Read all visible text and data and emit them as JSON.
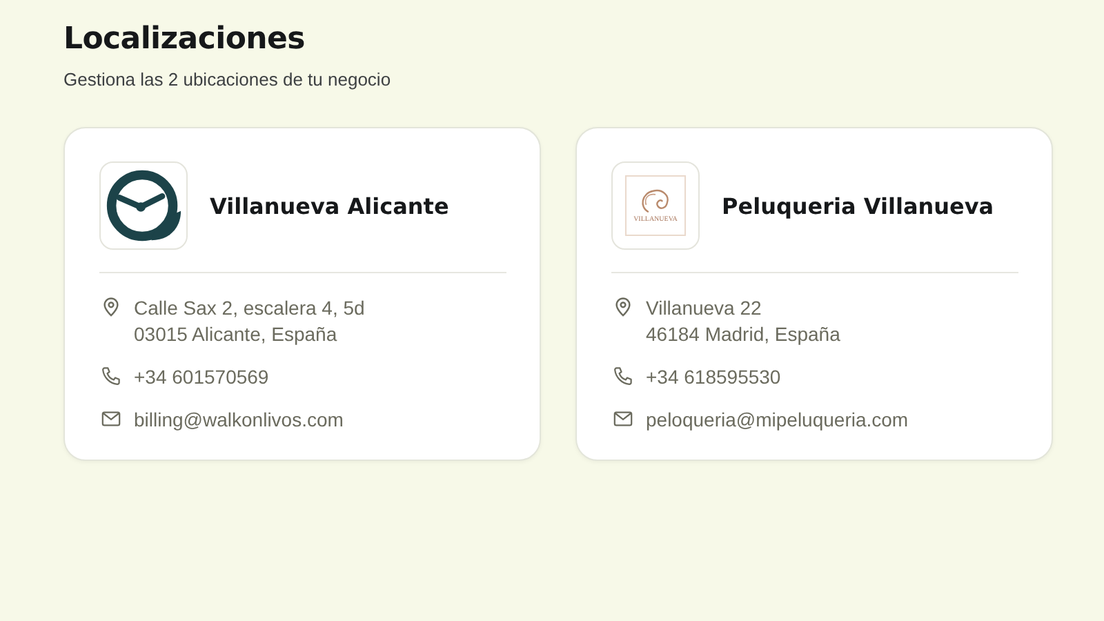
{
  "header": {
    "title": "Localizaciones",
    "subtitle": "Gestiona las 2 ubicaciones de tu negocio"
  },
  "locations": [
    {
      "name": "Villanueva Alicante",
      "logo": {
        "kind": "clock"
      },
      "address": [
        "Calle Sax 2, escalera 4, 5d",
        "03015 Alicante, España"
      ],
      "phone": "+34 601570569",
      "email": "billing@walkonlivos.com"
    },
    {
      "name": "Peluqueria Villanueva",
      "logo": {
        "kind": "salon",
        "text": "VILLANUEVA"
      },
      "address": [
        "Villanueva 22",
        "46184 Madrid, España"
      ],
      "phone": "+34 618595530",
      "email": "peloqueria@mipeluqueria.com"
    }
  ]
}
